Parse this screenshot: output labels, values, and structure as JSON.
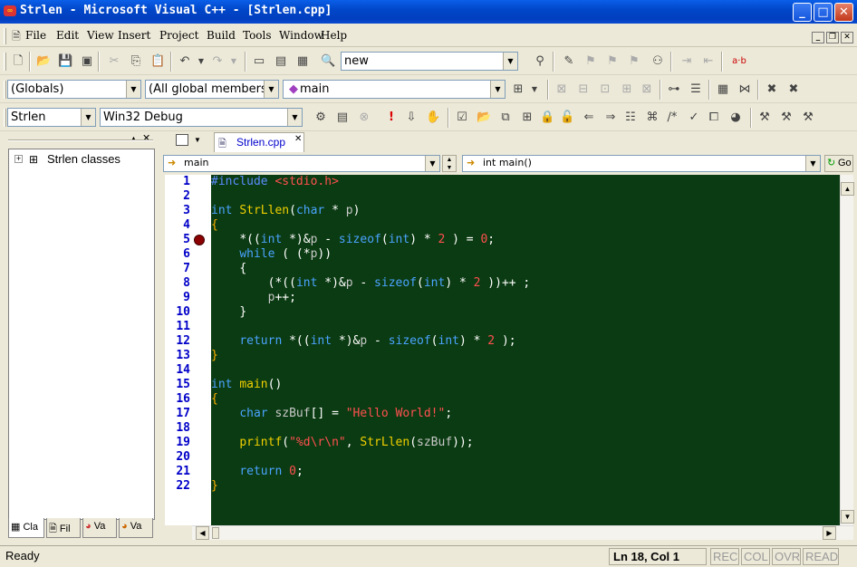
{
  "window": {
    "title": "Strlen - Microsoft Visual C++ - [Strlen.cpp]",
    "app_icon": "vc-icon"
  },
  "menu": [
    "File",
    "Edit",
    "View",
    "Insert",
    "Project",
    "Build",
    "Tools",
    "Window",
    "Help"
  ],
  "toolbar": {
    "find_combo_value": "new",
    "globals_combo": "(Globals)",
    "members_combo": "(All global members",
    "function_combo": "main",
    "project_combo": "Strlen",
    "config_combo": "Win32 Debug",
    "ab_label": "a·b"
  },
  "workspace": {
    "tree_root": "Strlen classes",
    "tabs": [
      "Cla",
      "Fil",
      "Va",
      "Va"
    ]
  },
  "editor": {
    "tab": "Strlen.cpp",
    "scope_combo": "main",
    "func_combo": "int main()",
    "go_button": "Go",
    "line_numbers": [
      "1",
      "2",
      "3",
      "4",
      "5",
      "6",
      "7",
      "8",
      "9",
      "10",
      "11",
      "12",
      "13",
      "14",
      "15",
      "16",
      "17",
      "18",
      "19",
      "20",
      "21",
      "22"
    ],
    "breakpoint_line": "5"
  },
  "status": {
    "message": "Ready",
    "position": "Ln 18, Col 1",
    "indicators": [
      "REC",
      "COL",
      "OVR",
      "READ"
    ]
  }
}
